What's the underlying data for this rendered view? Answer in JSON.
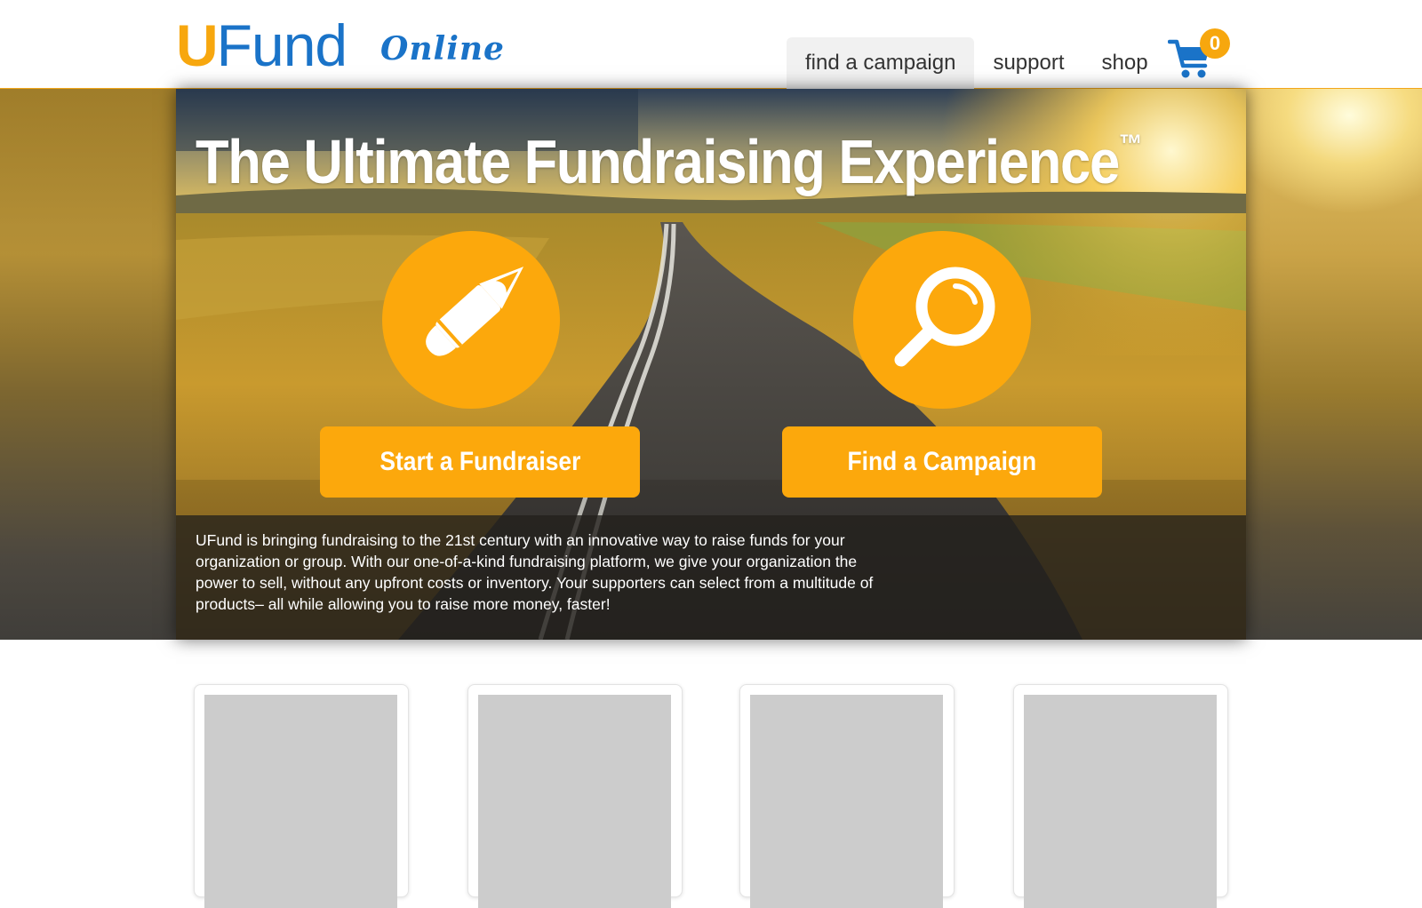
{
  "header": {
    "logo": {
      "u": "U",
      "fund": "Fund",
      "online": "Online"
    },
    "nav": [
      {
        "label": "find a campaign",
        "active": true
      },
      {
        "label": "support",
        "active": false
      },
      {
        "label": "shop",
        "active": false
      }
    ],
    "cart": {
      "icon": "cart-icon",
      "count": "0"
    }
  },
  "hero": {
    "title": "The Ultimate Fundraising Experience",
    "trademark": "™",
    "actions": [
      {
        "icon": "pencil-icon",
        "label": "Start a Fundraiser"
      },
      {
        "icon": "magnifier-icon",
        "label": "Find a Campaign"
      }
    ],
    "description": "UFund is bringing fundraising to the 21st century with an innovative way to raise funds for your organization or group. With our one-of-a-kind fundraising platform, we give your organization the power to sell, without any upfront costs or inventory. Your supporters can select from a multitude of products– all while allowing you to raise more money, faster!"
  },
  "colors": {
    "brand_orange": "#fca80c",
    "brand_blue": "#1a73c8",
    "nav_active_bg": "#f1f1f1",
    "placeholder_gray": "#cccccc"
  }
}
